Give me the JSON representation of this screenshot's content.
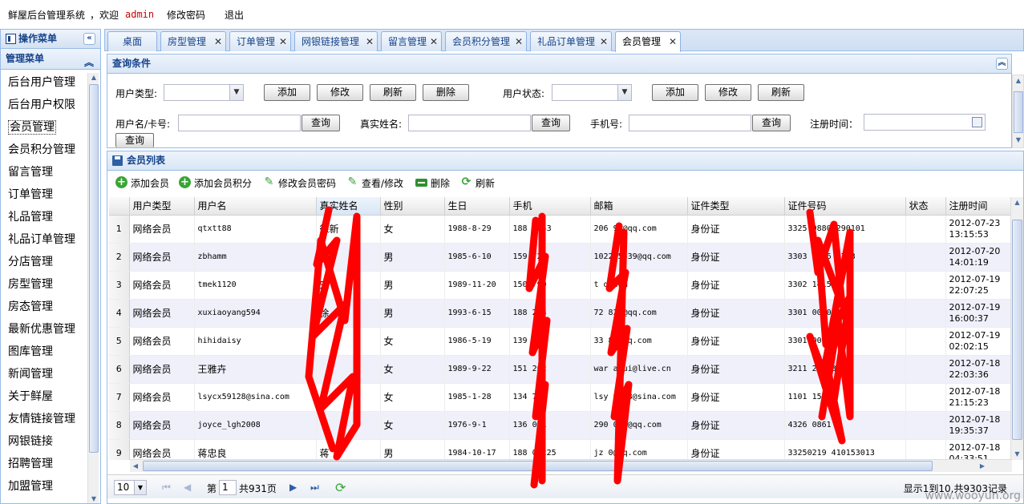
{
  "header": {
    "app_title": "鲜屋后台管理系统",
    "welcome": "，欢迎",
    "username": "admin",
    "change_password": "修改密码",
    "logout": "退出"
  },
  "sidebar": {
    "panel_title": "操作菜单",
    "section_title": "管理菜单",
    "items": [
      {
        "label": "后台用户管理"
      },
      {
        "label": "后台用户权限"
      },
      {
        "label": "会员管理"
      },
      {
        "label": "会员积分管理"
      },
      {
        "label": "留言管理"
      },
      {
        "label": "订单管理"
      },
      {
        "label": "礼品管理"
      },
      {
        "label": "礼品订单管理"
      },
      {
        "label": "分店管理"
      },
      {
        "label": "房型管理"
      },
      {
        "label": "房态管理"
      },
      {
        "label": "最新优惠管理"
      },
      {
        "label": "图库管理"
      },
      {
        "label": "新闻管理"
      },
      {
        "label": "关于鲜屋"
      },
      {
        "label": "友情链接管理"
      },
      {
        "label": "网银链接"
      },
      {
        "label": "招聘管理"
      },
      {
        "label": "加盟管理"
      }
    ],
    "active_index": 2
  },
  "tabs": [
    {
      "label": "桌面"
    },
    {
      "label": "房型管理"
    },
    {
      "label": "订单管理"
    },
    {
      "label": "网银链接管理"
    },
    {
      "label": "留言管理"
    },
    {
      "label": "会员积分管理"
    },
    {
      "label": "礼品订单管理"
    },
    {
      "label": "会员管理"
    }
  ],
  "query": {
    "title": "查询条件",
    "user_type_label": "用户类型:",
    "user_status_label": "用户状态:",
    "username_label": "用户名/卡号:",
    "realname_label": "真实姓名:",
    "phone_label": "手机号:",
    "regtime_label": "注册时间：",
    "add": "添加",
    "edit": "修改",
    "refresh": "刷新",
    "delete": "删除",
    "search": "查询"
  },
  "list": {
    "title": "会员列表",
    "toolbar": {
      "add_member": "添加会员",
      "add_points": "添加会员积分",
      "edit_password": "修改会员密码",
      "view_edit": "查看/修改",
      "delete": "删除",
      "refresh": "刷新"
    },
    "columns": [
      "用户类型",
      "用户名",
      "真实姓名",
      "性别",
      "生日",
      "手机",
      "邮箱",
      "证件类型",
      "证件号码",
      "状态",
      "注册时间"
    ],
    "rows": [
      {
        "num": "1",
        "type": "网络会员",
        "user": "qtxtt88",
        "name": "徐新",
        "sex": "女",
        "birth": "1988-8-29",
        "phone": "188  7843",
        "email": "206  91@qq.com",
        "idtype": "身份证",
        "idno": "3325  98808290101",
        "status": "",
        "date": "2012-07-23",
        "time": "13:15:53"
      },
      {
        "num": "2",
        "type": "网络会员",
        "user": "zbhamm",
        "name": "",
        "sex": "男",
        "birth": "1985-6-10",
        "phone": "159  721",
        "email": "1022  5539@qq.com",
        "idtype": "身份证",
        "idno": "3303  8506  4733",
        "status": "",
        "date": "2012-07-20",
        "time": "14:01:19"
      },
      {
        "num": "3",
        "type": "网络会员",
        "user": "tmek1120",
        "name": "宋",
        "sex": "男",
        "birth": "1989-11-20",
        "phone": "150  790",
        "email": "t  q.com",
        "idtype": "身份证",
        "idno": "3302  1415",
        "status": "",
        "date": "2012-07-19",
        "time": "22:07:25"
      },
      {
        "num": "4",
        "type": "网络会员",
        "user": "xuxiaoyang594",
        "name": "徐",
        "sex": "男",
        "birth": "1993-6-15",
        "phone": "188  263",
        "email": "72  821@qq.com",
        "idtype": "身份证",
        "idno": "3301  0010",
        "status": "",
        "date": "2012-07-19",
        "time": "16:00:37"
      },
      {
        "num": "5",
        "type": "网络会员",
        "user": "hihidaisy",
        "name": "",
        "sex": "女",
        "birth": "1986-5-19",
        "phone": "139  976",
        "email": "33  83@qq.com",
        "idtype": "身份证",
        "idno": "3301  0028",
        "status": "",
        "date": "2012-07-19",
        "time": "02:02:15"
      },
      {
        "num": "6",
        "type": "网络会员",
        "user": "王雅卉",
        "name": "",
        "sex": "女",
        "birth": "1989-9-22",
        "phone": "151  202",
        "email": "war  ahui@live.cn",
        "idtype": "身份证",
        "idno": "3211  20028",
        "status": "",
        "date": "2012-07-18",
        "time": "22:03:36"
      },
      {
        "num": "7",
        "type": "网络会员",
        "user": "lsycx59128@sina.com",
        "name": "",
        "sex": "女",
        "birth": "1985-1-28",
        "phone": "134  726",
        "email": "lsy  9128@sina.com",
        "idtype": "身份证",
        "idno": "1101  1569",
        "status": "",
        "date": "2012-07-18",
        "time": "21:15:23"
      },
      {
        "num": "8",
        "type": "网络会员",
        "user": "joyce_lgh2008",
        "name": "",
        "sex": "女",
        "birth": "1976-9-1",
        "phone": "136  071",
        "email": "290  020@qq.com",
        "idtype": "身份证",
        "idno": "4326  0861",
        "status": "",
        "date": "2012-07-18",
        "time": "19:35:37"
      },
      {
        "num": "9",
        "type": "网络会员",
        "user": "蒋忠良",
        "name": "蒋",
        "sex": "男",
        "birth": "1984-10-17",
        "phone": "188  01225",
        "email": "jz  0@qq.com",
        "idtype": "身份证",
        "idno": "33250219  410153013",
        "status": "",
        "date": "2012-07-18",
        "time": "04:33:51"
      }
    ],
    "pager": {
      "page_size": "10",
      "page_prefix": "第",
      "page": "1",
      "page_suffix": "共931页",
      "summary": "显示1到10,共9303记录"
    }
  },
  "watermark": "www.wooyun.org",
  "colors": {
    "accent": "#15428b",
    "border": "#99bbe8",
    "redaction": "#ff0000"
  }
}
